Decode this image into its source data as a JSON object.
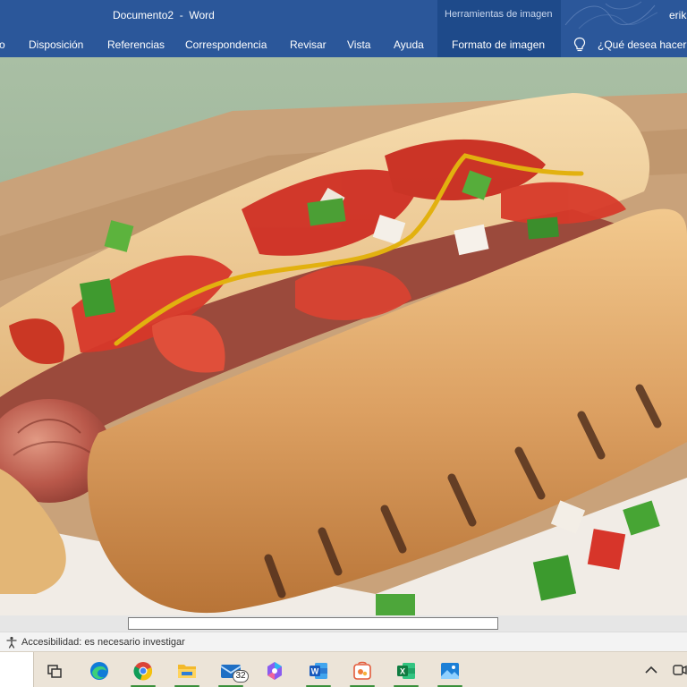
{
  "window": {
    "doc_name": "Documento2",
    "separator": "-",
    "app_name": "Word",
    "context_group": "Herramientas de imagen",
    "user": "erik"
  },
  "ribbon": {
    "tabs": [
      {
        "label": "o"
      },
      {
        "label": "Disposición"
      },
      {
        "label": "Referencias"
      },
      {
        "label": "Correspondencia"
      },
      {
        "label": "Revisar"
      },
      {
        "label": "Vista"
      },
      {
        "label": "Ayuda"
      },
      {
        "label": "Formato de imagen"
      }
    ],
    "tell_me": "¿Qué desea hacer?"
  },
  "status": {
    "accessibility": "Accesibilidad: es necesario investigar"
  },
  "taskbar": {
    "apps": [
      {
        "icon": "task-view-icon"
      },
      {
        "icon": "edge-icon"
      },
      {
        "icon": "chrome-icon"
      },
      {
        "icon": "file-explorer-icon"
      },
      {
        "icon": "mail-icon",
        "badge": "32"
      },
      {
        "icon": "copilot-icon"
      },
      {
        "icon": "word-icon"
      },
      {
        "icon": "paint-icon"
      },
      {
        "icon": "excel-icon"
      },
      {
        "icon": "photos-icon"
      }
    ]
  },
  "colors": {
    "word_blue": "#2b579a",
    "context_tab": "#1e4a8a",
    "taskbar": "#ece4d8"
  }
}
